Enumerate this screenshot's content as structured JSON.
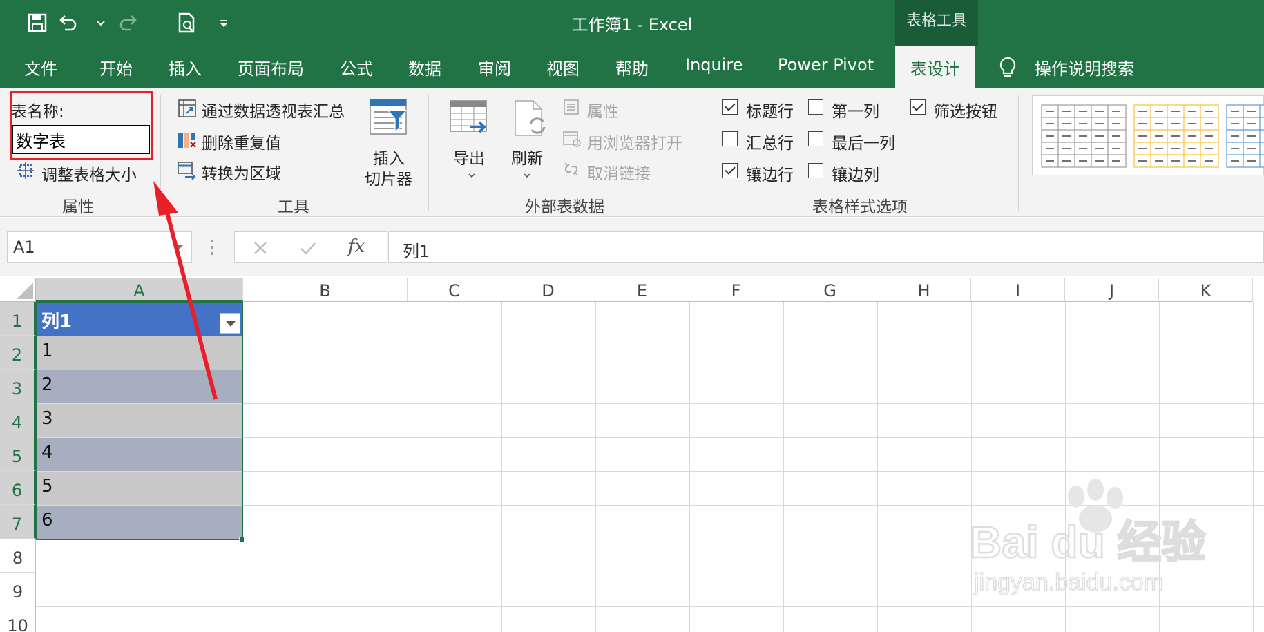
{
  "window": {
    "title": "工作簿1  -  Excel",
    "context_tab": "表格工具"
  },
  "tabs": [
    "文件",
    "开始",
    "插入",
    "页面布局",
    "公式",
    "数据",
    "审阅",
    "视图",
    "帮助",
    "Inquire",
    "Power Pivot",
    "表设计"
  ],
  "tell_me": "操作说明搜索",
  "ribbon": {
    "properties": {
      "table_name_label": "表名称:",
      "table_name_value": "数字表",
      "resize_label": "调整表格大小",
      "group": "属性"
    },
    "tools": {
      "summarize_pivot": "通过数据透视表汇总",
      "remove_duplicates": "删除重复值",
      "convert_to_range": "转换为区域",
      "insert_slicer_1": "插入",
      "insert_slicer_2": "切片器",
      "group": "工具"
    },
    "external": {
      "export": "导出",
      "refresh": "刷新",
      "properties": "属性",
      "open_in_browser": "用浏览器打开",
      "unlink": "取消链接",
      "group": "外部表数据"
    },
    "style_options": {
      "header_row": "标题行",
      "total_row": "汇总行",
      "banded_rows": "镶边行",
      "first_column": "第一列",
      "last_column": "最后一列",
      "banded_columns": "镶边列",
      "filter_button": "筛选按钮",
      "group": "表格样式选项",
      "checked": {
        "header_row": true,
        "total_row": false,
        "banded_rows": true,
        "first_column": false,
        "last_column": false,
        "banded_columns": false,
        "filter_button": true
      }
    }
  },
  "formula_bar": {
    "name_box": "A1",
    "fx": "fx",
    "content": "列1"
  },
  "columns": [
    "A",
    "B",
    "C",
    "D",
    "E",
    "F",
    "G",
    "H",
    "I",
    "J",
    "K"
  ],
  "rows": [
    "1",
    "2",
    "3",
    "4",
    "5",
    "6",
    "7",
    "8",
    "9",
    "10"
  ],
  "table": {
    "header": "列1",
    "values": [
      "1",
      "2",
      "3",
      "4",
      "5",
      "6"
    ]
  },
  "watermark": {
    "brand": "Bai du 经验",
    "url": "jingyan.baidu.com"
  },
  "colors": {
    "excel_green": "#217346",
    "table_header": "#4472c4",
    "band_dark": "#a6aec0",
    "band_light": "#c8c8c8",
    "annotation_red": "#e8202a"
  }
}
